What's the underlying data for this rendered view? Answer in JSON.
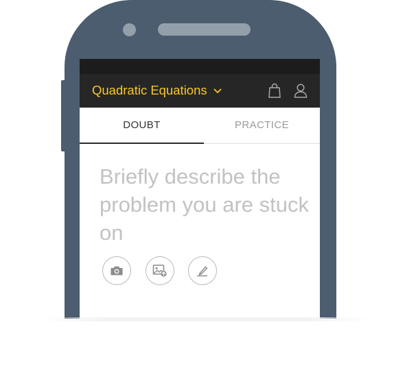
{
  "app_bar": {
    "title": "Quadratic Equations",
    "title_color": "#f7c72a",
    "background": "#262626",
    "icons": [
      "chevron-down-icon",
      "shopping-bag-icon",
      "user-icon"
    ]
  },
  "tabs": [
    {
      "label": "DOUBT",
      "active": true
    },
    {
      "label": "PRACTICE",
      "active": false
    }
  ],
  "prompt": {
    "placeholder": "Briefly describe the problem you are stuck on"
  },
  "actions": [
    {
      "icon": "camera-icon"
    },
    {
      "icon": "image-upload-icon"
    },
    {
      "icon": "pen-icon"
    }
  ],
  "device": {
    "body_color": "#4b5d6e",
    "accent_color": "#93a0ab"
  }
}
